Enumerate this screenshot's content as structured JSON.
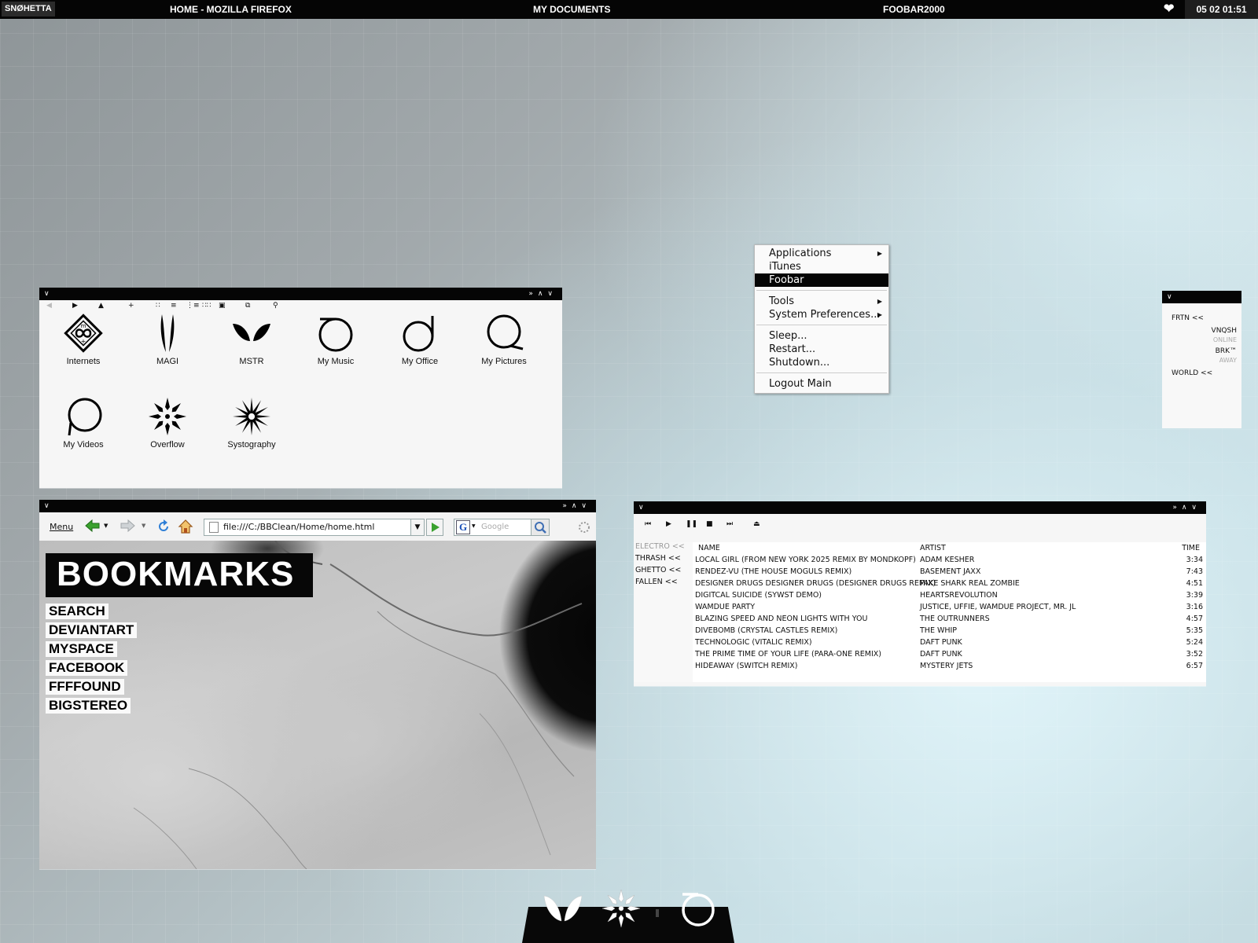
{
  "taskbar": {
    "logo": "SNØHETTA",
    "tasks": [
      "HOME - MOZILLA FIREFOX",
      "MY DOCUMENTS",
      "FOOBAR2000"
    ],
    "clock": "05 02 01:51"
  },
  "explorer": {
    "icons": [
      {
        "label": "Internets",
        "icon": "internets-icon"
      },
      {
        "label": "MAGI",
        "icon": "magi-icon"
      },
      {
        "label": "MSTR",
        "icon": "mstr-icon"
      },
      {
        "label": "My Music",
        "icon": "my-music-icon"
      },
      {
        "label": "My Office",
        "icon": "my-office-icon"
      },
      {
        "label": "My Pictures",
        "icon": "my-pictures-icon"
      },
      {
        "label": "My Videos",
        "icon": "my-videos-icon"
      },
      {
        "label": "Overflow",
        "icon": "overflow-icon"
      },
      {
        "label": "Systography",
        "icon": "systography-icon"
      }
    ]
  },
  "browser": {
    "menu": "Menu",
    "url": "file:///C:/BBClean/Home/home.html",
    "search_placeholder": "Google",
    "bookmarks_title": "BOOKMARKS",
    "links": [
      "SEARCH",
      "DEVIANTART",
      "MYSPACE",
      "FACEBOOK",
      "FFFFOUND",
      "BIGSTEREO"
    ]
  },
  "context_menu": {
    "items": [
      {
        "label": "Applications",
        "submenu": true
      },
      {
        "label": "iTunes",
        "submenu": false
      },
      {
        "label": "Foobar",
        "submenu": false,
        "selected": true
      },
      {
        "label": "Tools",
        "submenu": true
      },
      {
        "label": "System Preferences...",
        "submenu": true
      },
      {
        "label": "Sleep...",
        "submenu": false
      },
      {
        "label": "Restart...",
        "submenu": false
      },
      {
        "label": "Shutdown...",
        "submenu": false
      },
      {
        "label": "Logout Main",
        "submenu": false
      }
    ]
  },
  "buddy_list": {
    "group1": "FRTN <<",
    "contacts": [
      {
        "name": "VNQSH",
        "status": "ONLINE"
      },
      {
        "name": "BRK™",
        "status": "AWAY"
      }
    ],
    "group2": "WORLD <<"
  },
  "foobar": {
    "playlists": [
      "ELECTRO <<",
      "THRASH <<",
      "GHETTO <<",
      "FALLEN <<"
    ],
    "columns": {
      "name": "NAME",
      "artist": "ARTIST",
      "time": "TIME"
    },
    "tracks": [
      {
        "name": "LOCAL GIRL (FROM NEW YORK 2025 REMIX BY MONDKOPF)",
        "artist": "ADAM KESHER",
        "time": "3:34"
      },
      {
        "name": "RENDEZ-VU (THE HOUSE MOGULS REMIX)",
        "artist": "BASEMENT JAXX",
        "time": "7:43"
      },
      {
        "name": "DESIGNER DRUGS DESIGNER DRUGS (DESIGNER DRUGS REMIX)",
        "artist": "FAKE SHARK REAL ZOMBIE",
        "time": "4:51"
      },
      {
        "name": "DIGITCAL SUICIDE (SYWST DEMO)",
        "artist": "HEARTSREVOLUTION",
        "time": "3:39"
      },
      {
        "name": "WAMDUE PARTY",
        "artist": "JUSTICE, UFFIE, WAMDUE PROJECT, MR. JL",
        "time": "3:16"
      },
      {
        "name": "BLAZING SPEED AND NEON LIGHTS WITH YOU",
        "artist": "THE OUTRUNNERS",
        "time": "4:57"
      },
      {
        "name": "DIVEBOMB (CRYSTAL CASTLES REMIX)",
        "artist": "THE WHIP",
        "time": "5:35"
      },
      {
        "name": "TECHNOLOGIC (VITALIC REMIX)",
        "artist": "DAFT PUNK",
        "time": "5:24"
      },
      {
        "name": "THE PRIME TIME OF YOUR LIFE (PARA-ONE REMIX)",
        "artist": "DAFT PUNK",
        "time": "3:52"
      },
      {
        "name": "HIDEAWAY (SWITCH REMIX)",
        "artist": "MYSTERY JETS",
        "time": "6:57"
      }
    ]
  },
  "dock": {
    "items": [
      "mstr-icon",
      "overflow-icon",
      "my-music-icon"
    ]
  }
}
